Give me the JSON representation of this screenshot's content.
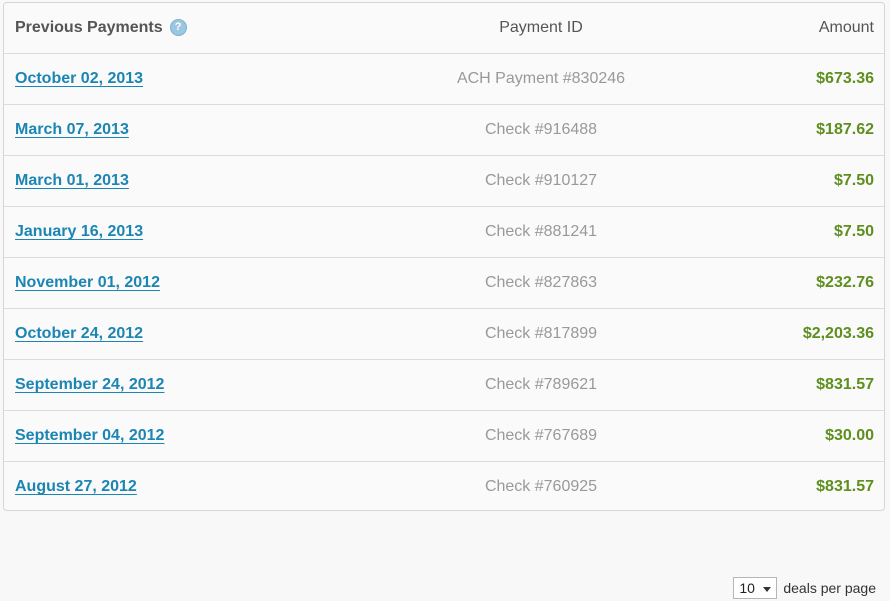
{
  "table": {
    "header": {
      "title": "Previous Payments",
      "help_icon": "?",
      "payment_id": "Payment ID",
      "amount": "Amount"
    },
    "rows": [
      {
        "date": "October 02, 2013",
        "payment_id": "ACH Payment #830246",
        "amount": "$673.36"
      },
      {
        "date": "March 07, 2013",
        "payment_id": "Check #916488",
        "amount": "$187.62"
      },
      {
        "date": "March 01, 2013",
        "payment_id": "Check #910127",
        "amount": "$7.50"
      },
      {
        "date": "January 16, 2013",
        "payment_id": "Check #881241",
        "amount": "$7.50"
      },
      {
        "date": "November 01, 2012",
        "payment_id": "Check #827863",
        "amount": "$232.76"
      },
      {
        "date": "October 24, 2012",
        "payment_id": "Check #817899",
        "amount": "$2,203.36"
      },
      {
        "date": "September 24, 2012",
        "payment_id": "Check #789621",
        "amount": "$831.57"
      },
      {
        "date": "September 04, 2012",
        "payment_id": "Check #767689",
        "amount": "$30.00"
      },
      {
        "date": "August 27, 2012",
        "payment_id": "Check #760925",
        "amount": "$831.57"
      }
    ]
  },
  "pagination": {
    "per_page_value": "10",
    "per_page_label": "deals per page"
  },
  "colors": {
    "link": "#1b85b3",
    "amount": "#5e8f1e",
    "muted": "#999999"
  }
}
